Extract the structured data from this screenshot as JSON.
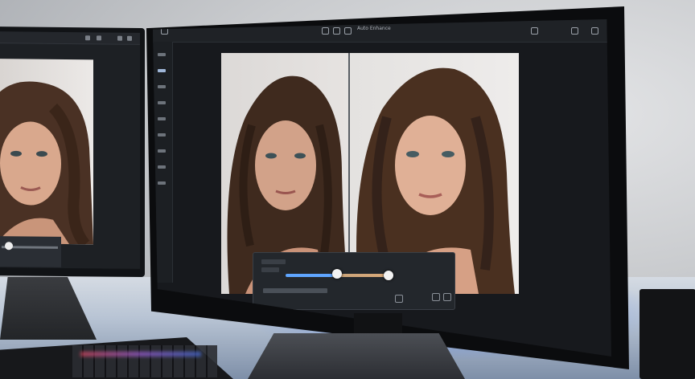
{
  "scene": {
    "colors": {
      "backlight": "#5f8cff",
      "ui_bg": "#17191d",
      "slider_accent": "#5fa5ff"
    },
    "editor": {
      "toolbar_label": "Auto Enhance",
      "compare_mode": "before-after-split",
      "slider_level": 0.55,
      "secondary_slider_level": 0.95
    },
    "icons": [
      "undo-icon",
      "redo-icon",
      "zoom-icon",
      "gear-icon",
      "share-icon"
    ]
  }
}
